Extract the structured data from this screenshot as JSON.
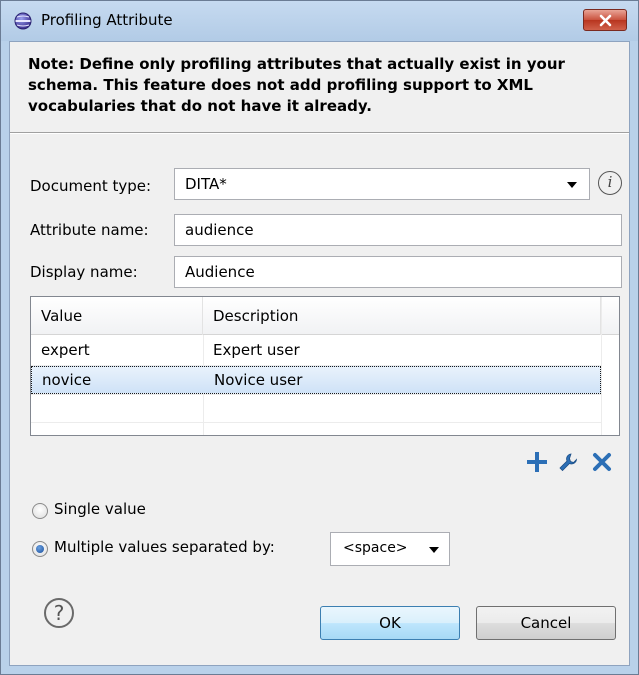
{
  "window": {
    "title": "Profiling Attribute"
  },
  "note": "Note: Define only profiling attributes that actually exist in your schema. This feature does not add profiling support to XML vocabularies that do not have it already.",
  "form": {
    "document_type_label": "Document type:",
    "document_type_value": "DITA*",
    "attribute_name_label": "Attribute name:",
    "attribute_name_value": "audience",
    "display_name_label": "Display name:",
    "display_name_value": "Audience"
  },
  "table": {
    "columns": [
      "Value",
      "Description"
    ],
    "rows": [
      {
        "value": "expert",
        "description": "Expert user"
      },
      {
        "value": "novice",
        "description": "Novice user"
      }
    ],
    "selected_row": 1
  },
  "table_actions": {
    "add_icon": "plus-icon",
    "edit_icon": "wrench-icon",
    "remove_icon": "delete-icon"
  },
  "options": {
    "single_value_label": "Single value",
    "multiple_values_label": "Multiple values separated by:",
    "selected": "multiple",
    "separator_value": "<space>"
  },
  "buttons": {
    "ok": "OK",
    "cancel": "Cancel"
  },
  "colors": {
    "accent_blue": "#3c7fb1",
    "close_red": "#c9513d",
    "selection": "#cfe2f7"
  }
}
